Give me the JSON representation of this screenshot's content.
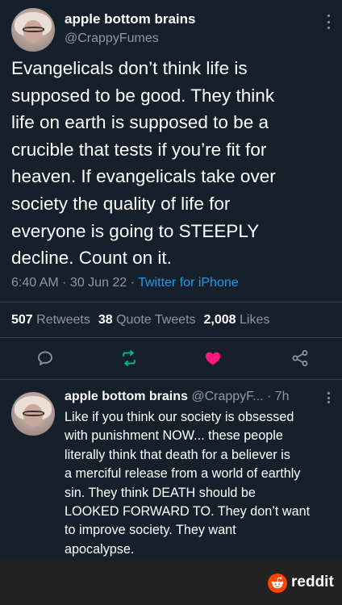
{
  "tweet": {
    "author_name": "apple bottom brains",
    "author_handle": "@CrappyFumes",
    "text": "Evangelicals don’t think life is\nsupposed to be good. They think\nlife on earth is supposed to be a\ncrucible that tests if you’re fit for\nheaven. If evangelicals take over\nsociety the quality of life for\neveryone is going to STEEPLY\ndecline. Count on it.",
    "time": "6:40 AM",
    "date": "30 Jun 22",
    "source": "Twitter for iPhone",
    "separator": " · "
  },
  "stats": {
    "retweets_count": "507",
    "retweets_label": " Retweets",
    "quotes_count": "38",
    "quotes_label": " Quote Tweets",
    "likes_count": "2,008",
    "likes_label": " Likes"
  },
  "actions": {
    "reply_icon": "comment-icon",
    "retweet_icon": "retweet-icon",
    "like_icon": "heart-filled-icon",
    "share_icon": "share-icon"
  },
  "reply": {
    "author_name": "apple bottom brains",
    "author_handle": "@CrappyF...",
    "time": "· 7h",
    "text": "Like if you think our society is obsessed\nwith punishment NOW... these people\nliterally think that death for a believer is\na merciful release from a world of earthly\nsin. They think DEATH should be\nLOOKED FORWARD TO. They don’t want\nto improve society. They want\napocalypse."
  },
  "watermark": {
    "label": "reddit"
  },
  "colors": {
    "background": "#15202b",
    "secondary_text": "#8b98a5",
    "link": "#1d9bf0",
    "like": "#f91880",
    "retweet": "#00ba7c",
    "reddit_orange": "#ff4500"
  }
}
